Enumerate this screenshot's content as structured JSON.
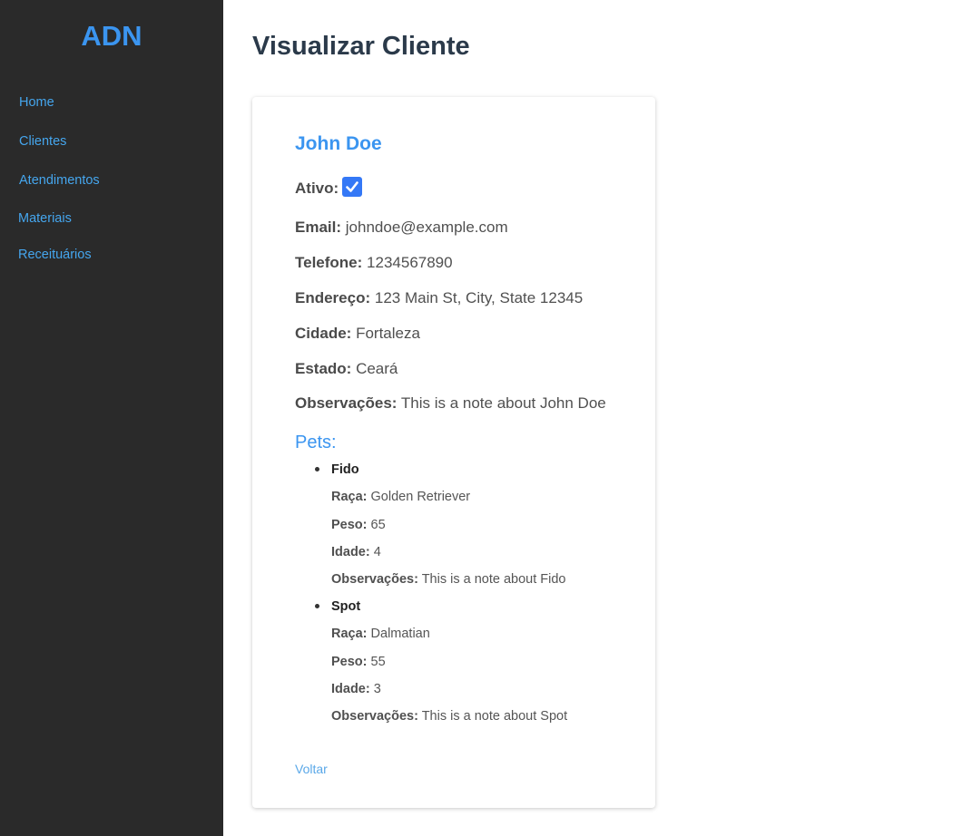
{
  "sidebar": {
    "logo": "ADN",
    "items": [
      {
        "label": "Home"
      },
      {
        "label": "Clientes"
      },
      {
        "label": "Atendimentos"
      },
      {
        "label": "Materiais"
      },
      {
        "label": "Receituários"
      }
    ]
  },
  "page": {
    "title": "Visualizar Cliente"
  },
  "client": {
    "name": "John Doe",
    "active_label": "Ativo:",
    "active": true,
    "fields": [
      {
        "label": "Email:",
        "value": "johndoe@example.com"
      },
      {
        "label": "Telefone:",
        "value": "1234567890"
      },
      {
        "label": "Endereço:",
        "value": "123 Main St, City, State 12345"
      },
      {
        "label": "Cidade:",
        "value": "Fortaleza"
      },
      {
        "label": "Estado:",
        "value": "Ceará"
      },
      {
        "label": "Observações:",
        "value": "This is a note about John Doe"
      }
    ]
  },
  "pets": {
    "title": "Pets:",
    "items": [
      {
        "name": "Fido",
        "fields": [
          {
            "label": "Raça:",
            "value": "Golden Retriever"
          },
          {
            "label": "Peso:",
            "value": "65"
          },
          {
            "label": "Idade:",
            "value": "4"
          },
          {
            "label": "Observações:",
            "value": "This is a note about Fido"
          }
        ]
      },
      {
        "name": "Spot",
        "fields": [
          {
            "label": "Raça:",
            "value": "Dalmatian"
          },
          {
            "label": "Peso:",
            "value": "55"
          },
          {
            "label": "Idade:",
            "value": "3"
          },
          {
            "label": "Observações:",
            "value": "This is a note about Spot"
          }
        ]
      }
    ]
  },
  "back_label": "Voltar",
  "colors": {
    "sidebar_bg": "#2a2a2a",
    "accent": "#3b95f0",
    "link": "#45a6ee",
    "checkbox": "#3478f6"
  }
}
